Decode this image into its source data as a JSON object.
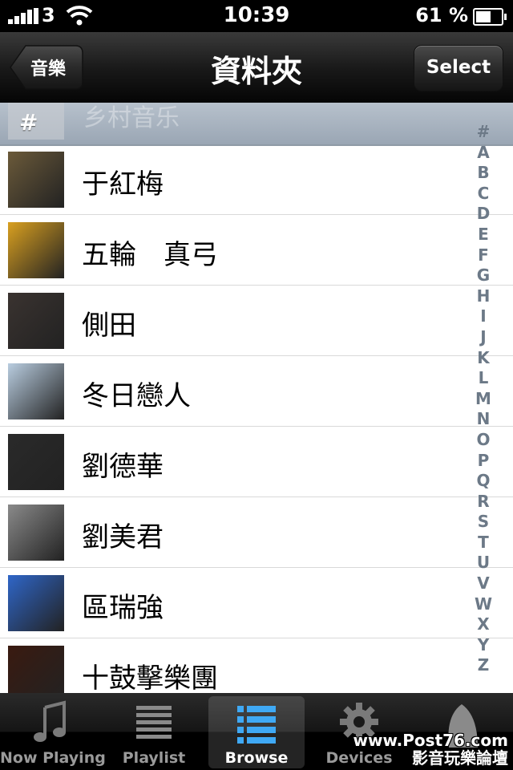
{
  "status_bar": {
    "carrier": "3",
    "time": "10:39",
    "battery_percent": "61 %",
    "battery_level": 0.61
  },
  "nav": {
    "back_label": "音樂",
    "title": "資料夾",
    "select_label": "Select"
  },
  "section": {
    "letter": "#",
    "ghost_label": "乡村音乐"
  },
  "rows": [
    {
      "label": "于紅梅",
      "art_color": "#6b5a3a"
    },
    {
      "label": "五輪　真弓",
      "art_color": "#d9a020"
    },
    {
      "label": "側田",
      "art_color": "#3a3330"
    },
    {
      "label": "冬日戀人",
      "art_color": "#b9cde0"
    },
    {
      "label": "劉德華",
      "art_color": "#2a2a2a"
    },
    {
      "label": "劉美君",
      "art_color": "#8a8a8a"
    },
    {
      "label": "區瑞強",
      "art_color": "#2f66c8"
    },
    {
      "label": "十鼓擊樂團",
      "art_color": "#3a1a10"
    }
  ],
  "index_letters": [
    "#",
    "A",
    "B",
    "C",
    "D",
    "E",
    "F",
    "G",
    "H",
    "I",
    "J",
    "K",
    "L",
    "M",
    "N",
    "O",
    "P",
    "Q",
    "R",
    "S",
    "T",
    "U",
    "V",
    "W",
    "X",
    "Y",
    "Z"
  ],
  "tabs": [
    {
      "label": "Now Playing",
      "icon": "music-note-icon",
      "active": false
    },
    {
      "label": "Playlist",
      "icon": "list-icon",
      "active": false
    },
    {
      "label": "Browse",
      "icon": "browse-list-icon",
      "active": true
    },
    {
      "label": "Devices",
      "icon": "gear-icon",
      "active": false
    },
    {
      "label": "",
      "icon": "more-icon",
      "active": false
    }
  ],
  "watermark": {
    "line1": "www.Post76.com",
    "line2": "影音玩樂論壇"
  }
}
